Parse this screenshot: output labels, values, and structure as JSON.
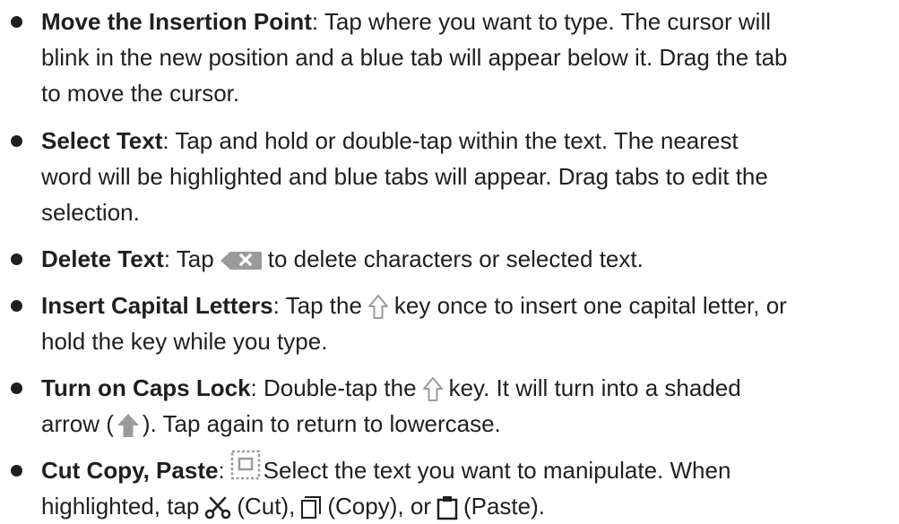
{
  "items": [
    {
      "term": "Move the Insertion Point",
      "sep": ":",
      "lines": [
        " Tap where you want to type. The cursor will",
        "blink in the new position and a blue tab will appear below it. Drag the tab",
        "to move the cursor."
      ]
    },
    {
      "term": "Select Text",
      "sep": ":",
      "lines": [
        " Tap and hold or double-tap within the text. The nearest",
        "word will be highlighted and blue tabs will appear. Drag tabs to edit the",
        "selection."
      ]
    },
    {
      "term": "Delete Text",
      "sep": ":",
      "pre_icon": " Tap",
      "post_icon": "to delete characters or selected text."
    },
    {
      "term": "Insert Capital Letters",
      "sep": ":",
      "pre_icon": " Tap the",
      "post_icon": "key once to insert one capital letter, or",
      "line2": "hold the key while you type."
    },
    {
      "term": "Turn on Caps Lock",
      "sep": ":",
      "pre_icon": " Double-tap the",
      "post_icon": "key. It will turn into a shaded",
      "line2_pre": "arrow (",
      "line2_post": "). Tap again to return to lowercase."
    },
    {
      "term": "Cut Copy, Paste",
      "sep": ":",
      "post_icon": "Select the text you want to manipulate. When",
      "line2_pre": "highlighted, tap",
      "cut_label": "(Cut),",
      "copy_label": "(Copy), or",
      "paste_label": "(Paste)."
    }
  ],
  "icons": {
    "delete": "delete-key-icon",
    "shift": "shift-key-icon",
    "shaded_arrow": "caps-lock-arrow-icon",
    "select_box": "selection-box-icon",
    "scissors": "scissors-icon",
    "copy": "copy-icon",
    "paste": "clipboard-icon",
    "icon_gray": "#9a9a9a",
    "text_color": "#1f1f1f"
  }
}
